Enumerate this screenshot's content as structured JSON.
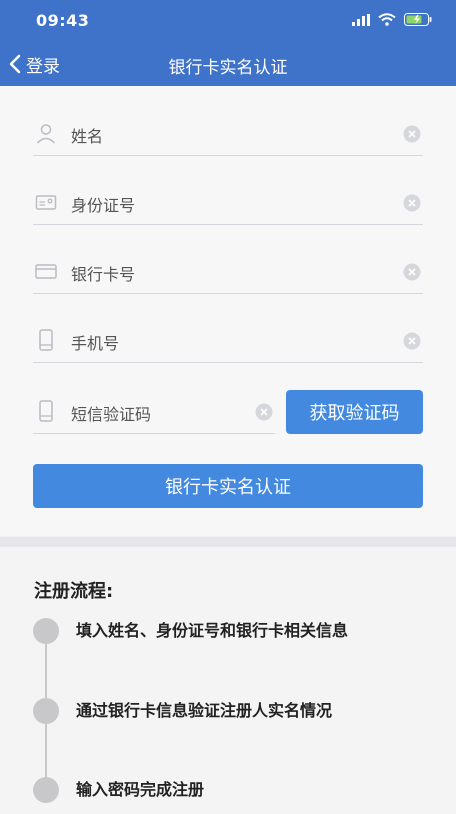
{
  "status_bar": {
    "time": "09:43"
  },
  "nav": {
    "back_label": "登录",
    "title": "银行卡实名认证"
  },
  "form": {
    "name_placeholder": "姓名",
    "id_placeholder": "身份证号",
    "card_placeholder": "银行卡号",
    "phone_placeholder": "手机号",
    "sms_placeholder": "短信验证码",
    "get_code_label": "获取验证码",
    "submit_label": "银行卡实名认证"
  },
  "process": {
    "title": "注册流程:",
    "steps": [
      {
        "text": "填入姓名、身份证号和银行卡相关信息"
      },
      {
        "text": "通过银行卡信息验证注册人实名情况"
      },
      {
        "text": "输入密码完成注册"
      }
    ]
  },
  "colors": {
    "header": "#3f72c9",
    "button": "#4289df"
  }
}
